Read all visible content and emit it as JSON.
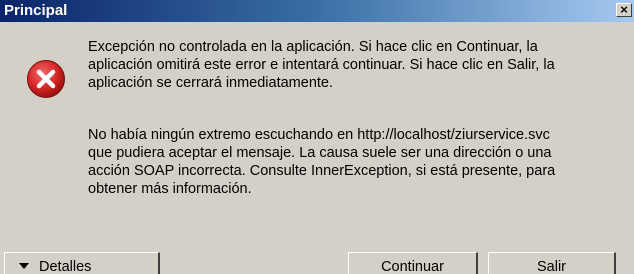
{
  "window": {
    "title": "Principal",
    "close_glyph": "×"
  },
  "message": {
    "icon": "error-icon",
    "paragraph1": "Excepción no controlada en la aplicación. Si hace clic en Continuar, la\naplicación omitirá este error e intentará continuar. Si hace clic en Salir, la\naplicación se cerrará inmediatamente.",
    "paragraph2": "No había ningún extremo escuchando en http://localhost/ziurservice.svc\nque pudiera aceptar el mensaje. La causa suele ser una dirección o una\nacción SOAP incorrecta. Consulte InnerException, si está presente, para\nobtener más información."
  },
  "buttons": {
    "details": "Detalles",
    "continue": "Continuar",
    "exit": "Salir"
  },
  "colors": {
    "titlebar_start": "#0a246a",
    "titlebar_end": "#a6caf0",
    "face": "#d4d0c8",
    "error_red": "#d62828"
  }
}
